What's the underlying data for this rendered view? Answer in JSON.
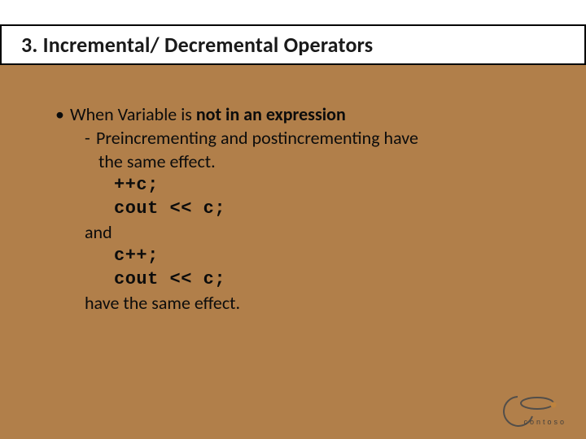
{
  "title": "3. Incremental/ Decremental Operators",
  "bullet": {
    "prefix": "When Variable is ",
    "bold": "not in an expression"
  },
  "sub_line1": "Preincrementing and postincrementing have",
  "sub_line2": "the same effect.",
  "code1": "++c;",
  "code2": "cout << c;",
  "and_word": "and",
  "code3": "c++;",
  "code4": "cout << c;",
  "closing": "have the same effect.",
  "logo_text": "contoso"
}
